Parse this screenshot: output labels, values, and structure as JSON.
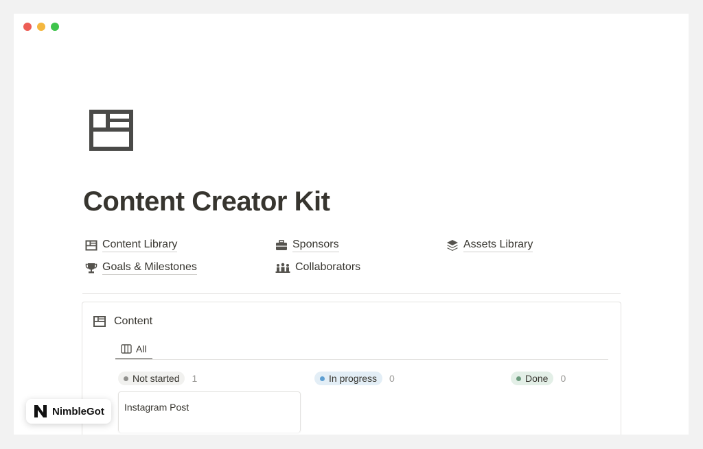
{
  "page": {
    "title": "Content Creator Kit",
    "icon": "window-layout-icon"
  },
  "links": [
    {
      "label": "Content Library",
      "icon": "layout-icon"
    },
    {
      "label": "Sponsors",
      "icon": "briefcase-icon"
    },
    {
      "label": "Assets Library",
      "icon": "layers-icon"
    },
    {
      "label": "Goals & Milestones",
      "icon": "trophy-icon"
    },
    {
      "label": "Collaborators",
      "icon": "people-icon"
    }
  ],
  "database": {
    "title": "Content",
    "icon": "layout-icon",
    "view_tab": {
      "label": "All",
      "icon": "board-icon"
    },
    "groups": [
      {
        "label": "Not started",
        "count": "1",
        "color": "#91918e",
        "bg": "#f1f1ef"
      },
      {
        "label": "In progress",
        "count": "0",
        "color": "#5e9fd2",
        "bg": "#e3eef6"
      },
      {
        "label": "Done",
        "count": "0",
        "color": "#6c9b7d",
        "bg": "#e3efe7"
      }
    ],
    "cards": [
      {
        "title": "Instagram Post"
      }
    ]
  },
  "watermark": {
    "text": "NimbleGot"
  },
  "colors": {
    "red": "#ed5d55",
    "yellow": "#f4b73f",
    "green": "#3ec44b"
  }
}
